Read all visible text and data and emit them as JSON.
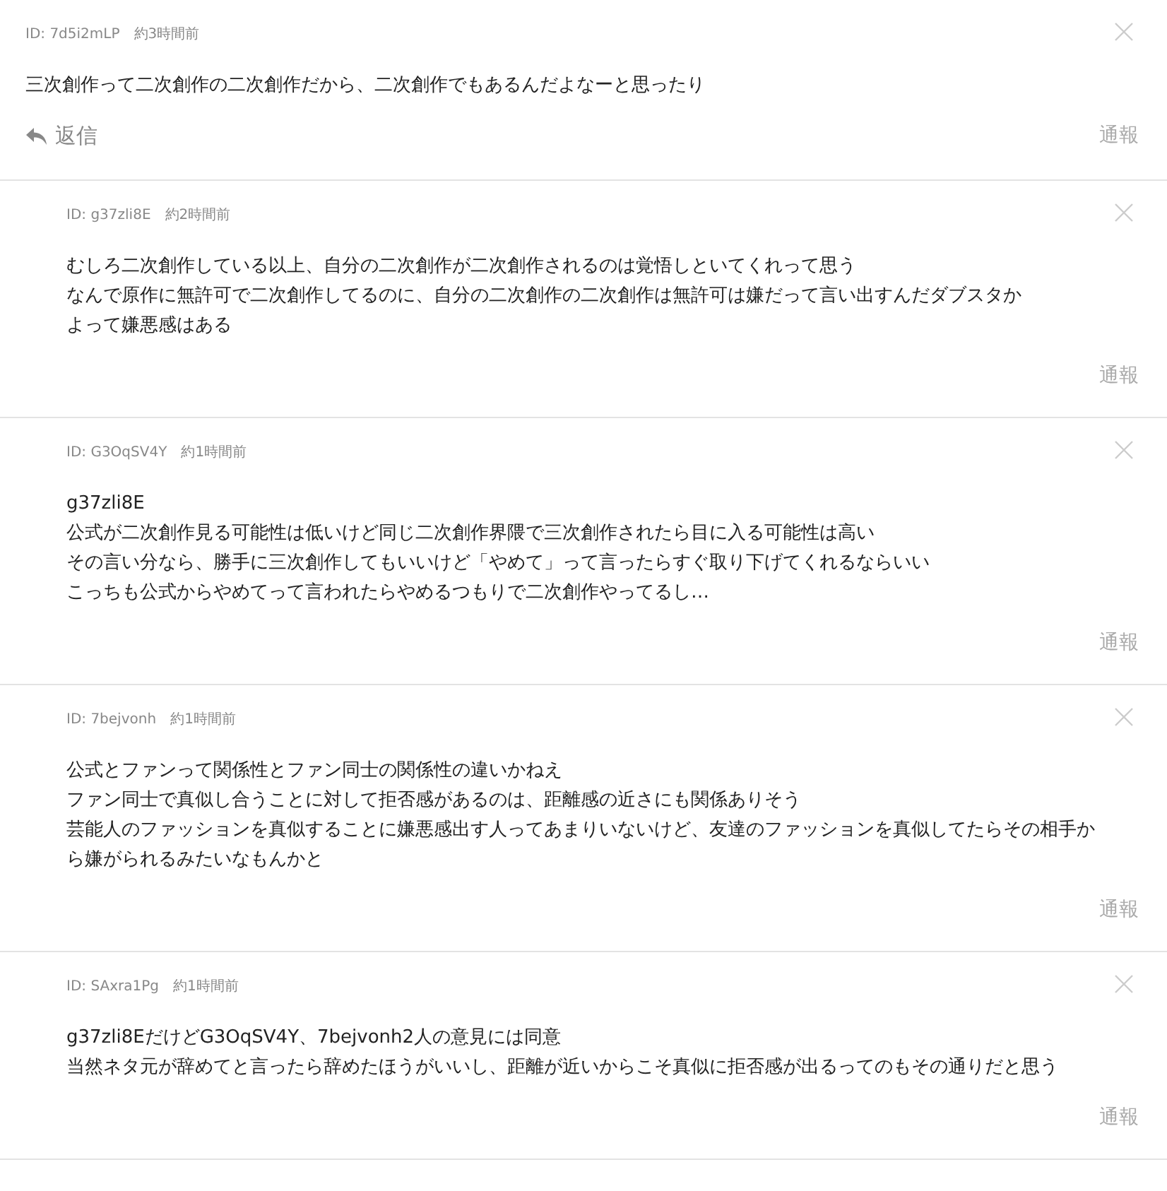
{
  "comments": [
    {
      "is_reply": false,
      "id_label": "ID: 7d5i2mLP",
      "time": "約3時間前",
      "lines": [
        "三次創作って二次創作の二次創作だから、二次創作でもあるんだよなーと思ったり"
      ],
      "reply_button": "返信",
      "report": "通報"
    },
    {
      "is_reply": true,
      "id_label": "ID: g37zli8E",
      "time": "約2時間前",
      "lines": [
        "むしろ二次創作している以上、自分の二次創作が二次創作されるのは覚悟しといてくれって思う",
        "なんで原作に無許可で二次創作してるのに、自分の二次創作の二次創作は無許可は嫌だって言い出すんだダブスタか",
        "よって嫌悪感はある"
      ],
      "report": "通報"
    },
    {
      "is_reply": true,
      "id_label": "ID: G3OqSV4Y",
      "time": "約1時間前",
      "lines": [
        "g37zli8E",
        "公式が二次創作見る可能性は低いけど同じ二次創作界隈で三次創作されたら目に入る可能性は高い",
        "その言い分なら、勝手に三次創作してもいいけど「やめて」って言ったらすぐ取り下げてくれるならいい",
        "こっちも公式からやめてって言われたらやめるつもりで二次創作やってるし…"
      ],
      "report": "通報"
    },
    {
      "is_reply": true,
      "id_label": "ID: 7bejvonh",
      "time": "約1時間前",
      "lines": [
        "公式とファンって関係性とファン同士の関係性の違いかねえ",
        "ファン同士で真似し合うことに対して拒否感があるのは、距離感の近さにも関係ありそう",
        "芸能人のファッションを真似することに嫌悪感出す人ってあまりいないけど、友達のファッションを真似してたらその相手か",
        "ら嫌がられるみたいなもんかと"
      ],
      "report": "通報"
    },
    {
      "is_reply": true,
      "id_label": "ID: SAxra1Pg",
      "time": "約1時間前",
      "lines": [
        "g37zli8EだけどG3OqSV4Y、7bejvonh2人の意見には同意",
        "当然ネタ元が辞めてと言ったら辞めたほうがいいし、距離が近いからこそ真似に拒否感が出るってのもその通りだと思う"
      ],
      "report": "通報"
    }
  ]
}
